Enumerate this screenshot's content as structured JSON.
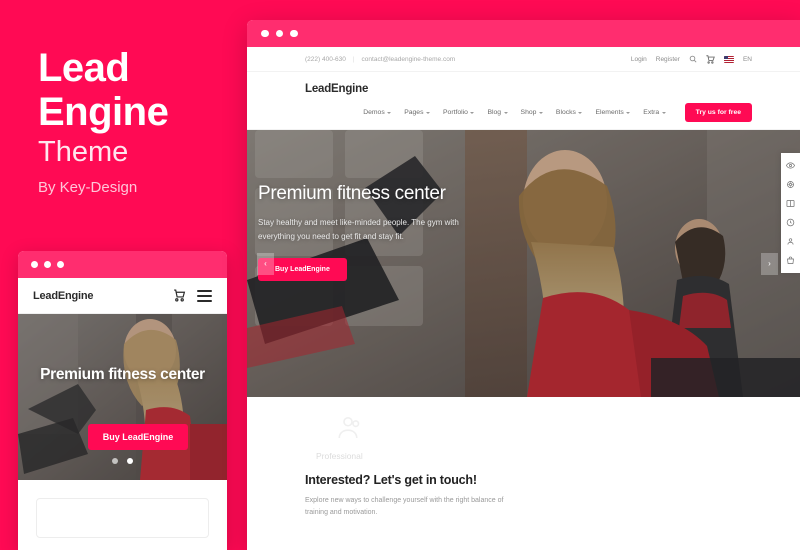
{
  "promo": {
    "title_line1": "Lead",
    "title_line2": "Engine",
    "subtitle": "Theme",
    "byline": "By Key-Design"
  },
  "colors": {
    "brand_pink": "#ff0a54",
    "titlebar_pink": "#ff2d6f",
    "text_dark": "#2b2b2b",
    "muted": "#9a9a9a"
  },
  "mobile": {
    "logo": "LeadEngine",
    "cart_icon": "cart-icon",
    "menu_icon": "hamburger-icon",
    "hero_title": "Premium fitness center",
    "cta_label": "Buy LeadEngine",
    "dots": [
      "dot-1",
      "dot-2"
    ]
  },
  "browser": {
    "topbar": {
      "phone": "(222) 400-630",
      "separator": "|",
      "email": "contact@leadengine-theme.com",
      "login": "Login",
      "register": "Register",
      "search_icon": "search-icon",
      "cart_icon": "cart-icon",
      "flag_icon": "us-flag-icon",
      "language": "EN"
    },
    "nav": {
      "brand": "LeadEngine",
      "items": [
        {
          "label": "Demos"
        },
        {
          "label": "Pages"
        },
        {
          "label": "Portfolio"
        },
        {
          "label": "Blog"
        },
        {
          "label": "Shop"
        },
        {
          "label": "Blocks"
        },
        {
          "label": "Elements"
        },
        {
          "label": "Extra"
        }
      ],
      "cta_label": "Try us for free"
    },
    "hero": {
      "title": "Premium fitness center",
      "text": "Stay healthy and meet like-minded people. The gym with everything you need to get fit and stay fit.",
      "cta_label": "Buy LeadEngine",
      "prev_arrow": "‹",
      "next_arrow": "›"
    },
    "side_tools": [
      {
        "name": "eye-icon"
      },
      {
        "name": "gear-icon"
      },
      {
        "name": "book-icon"
      },
      {
        "name": "clock-icon"
      },
      {
        "name": "people-icon"
      },
      {
        "name": "bag-icon"
      }
    ],
    "section": {
      "ghost_label": "Professional",
      "title": "Interested? Let's get in touch!",
      "text": "Explore new ways to challenge yourself with the right balance of training and motivation."
    }
  }
}
